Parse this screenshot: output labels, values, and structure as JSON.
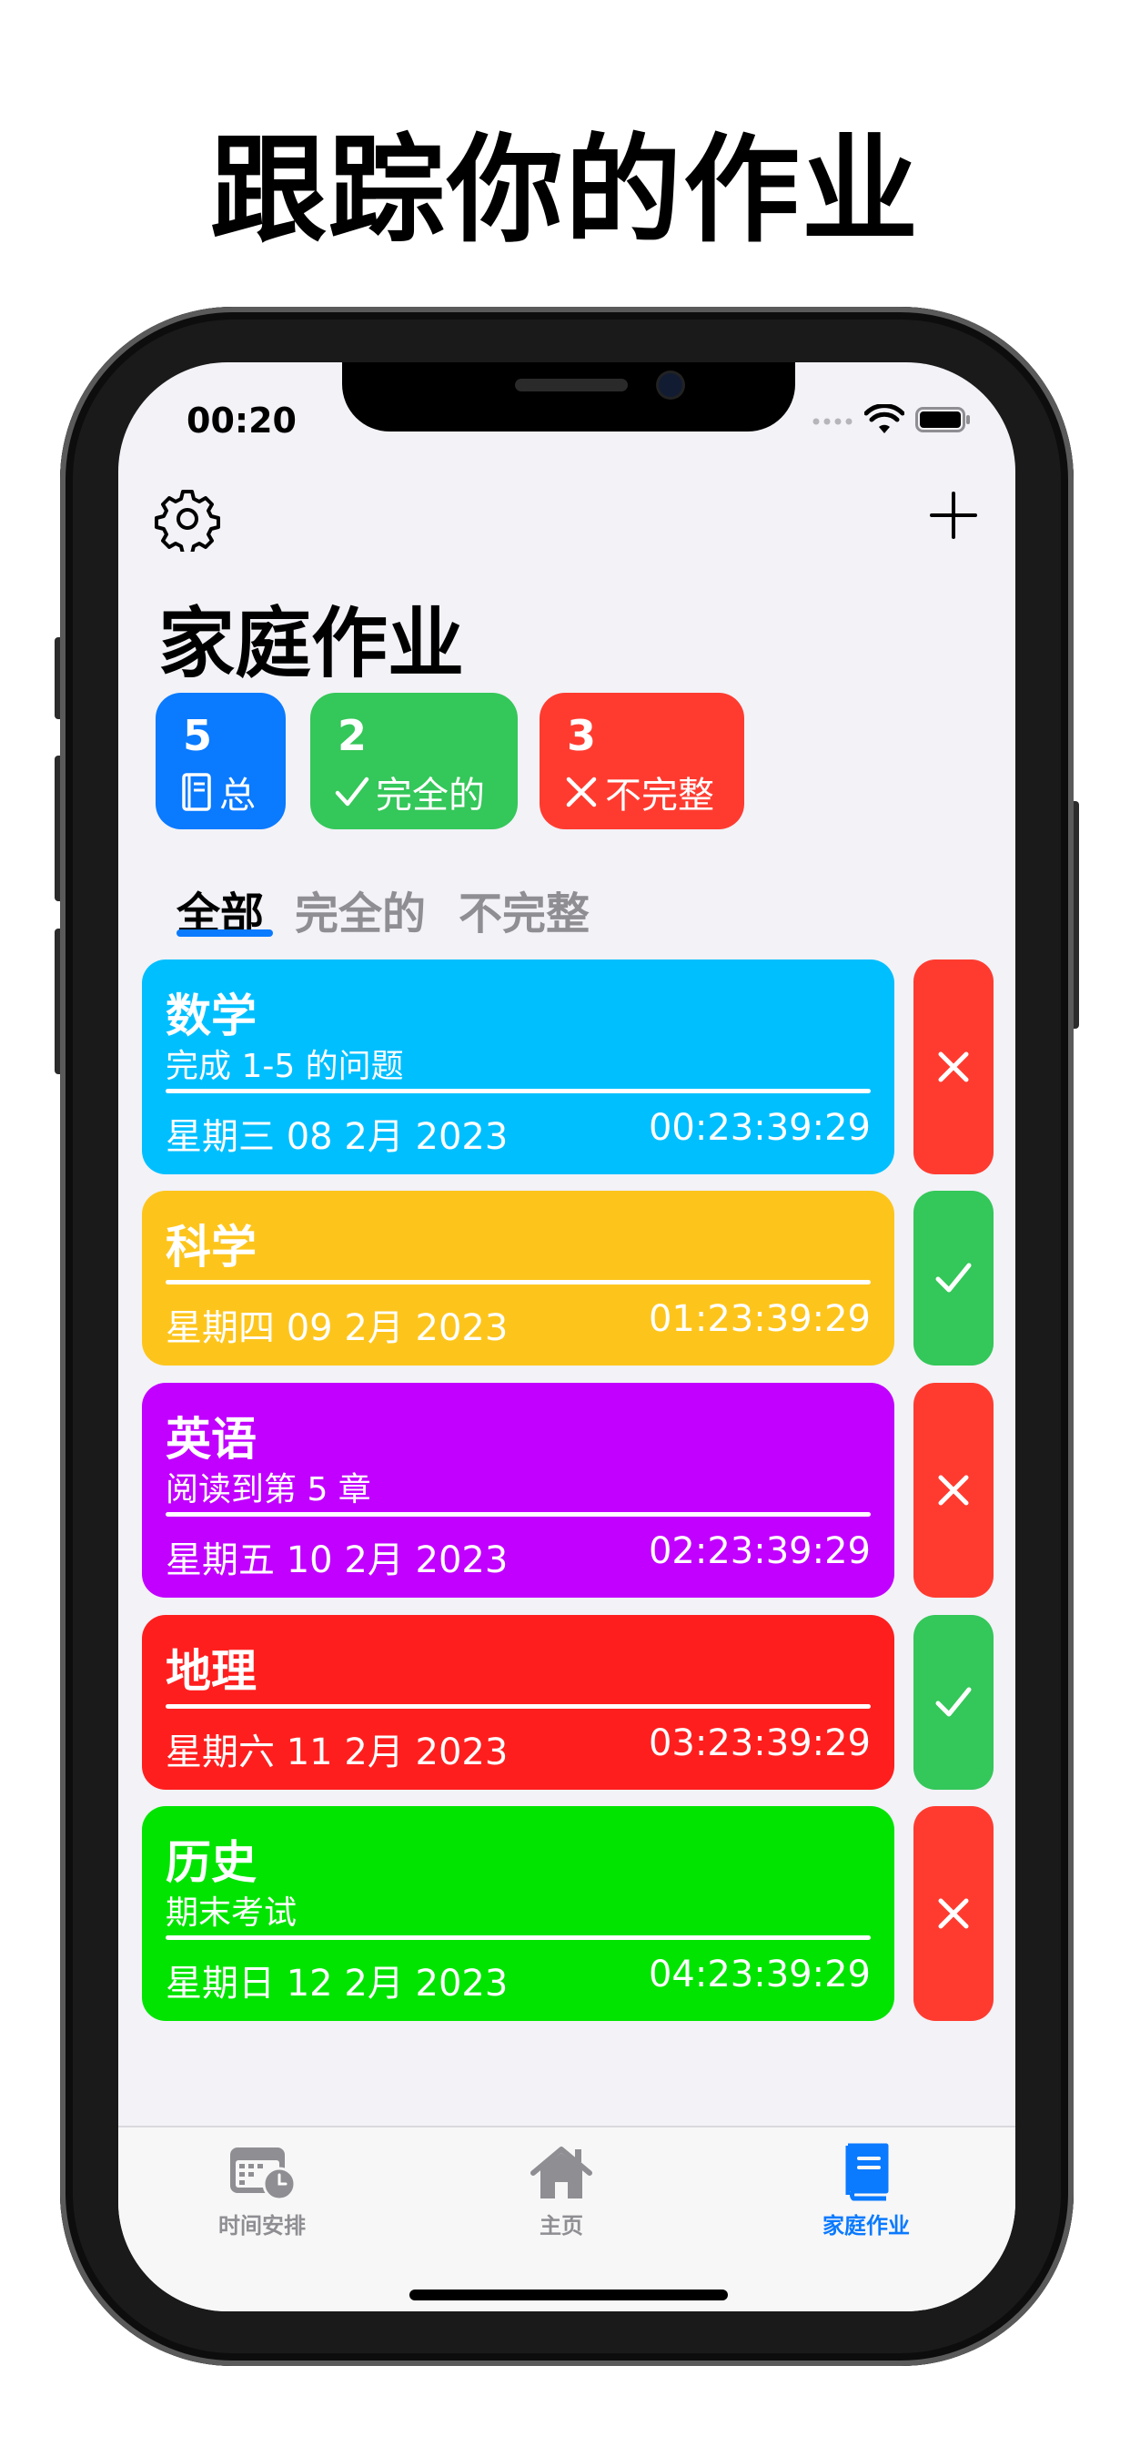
{
  "headline": "跟踪你的作业",
  "status_bar": {
    "time": "00:20"
  },
  "header": {
    "title": "家庭作业",
    "settings_icon": "gear-icon",
    "add_icon": "plus-icon"
  },
  "stats": [
    {
      "count": "5",
      "label": "总",
      "icon": "notebook-icon",
      "color": "#0a7aff"
    },
    {
      "count": "2",
      "label": "完全的",
      "icon": "checkmark-icon",
      "color": "#34c759"
    },
    {
      "count": "3",
      "label": "不完整",
      "icon": "xmark-icon",
      "color": "#ff3b30"
    }
  ],
  "filter_tabs": [
    {
      "label": "全部",
      "selected": true
    },
    {
      "label": "完全的",
      "selected": false
    },
    {
      "label": "不完整",
      "selected": false
    }
  ],
  "assignments": [
    {
      "subject": "数学",
      "description": "完成 1-5 的问题",
      "date": "星期三 08 2月 2023",
      "remaining": "00:23:39:29",
      "color": "#00bfff",
      "status": "incomplete",
      "action_icon": "xmark-icon"
    },
    {
      "subject": "科学",
      "description": "",
      "date": "星期四 09 2月 2023",
      "remaining": "01:23:39:29",
      "color": "#fdc51c",
      "status": "complete",
      "action_icon": "checkmark-icon"
    },
    {
      "subject": "英语",
      "description": "阅读到第 5 章",
      "date": "星期五 10 2月 2023",
      "remaining": "02:23:39:29",
      "color": "#c100ff",
      "status": "incomplete",
      "action_icon": "xmark-icon"
    },
    {
      "subject": "地理",
      "description": "",
      "date": "星期六 11 2月 2023",
      "remaining": "03:23:39:29",
      "color": "#ff1e1e",
      "status": "complete",
      "action_icon": "checkmark-icon"
    },
    {
      "subject": "历史",
      "description": "期末考试",
      "date": "星期日 12 2月 2023",
      "remaining": "04:23:39:29",
      "color": "#00e400",
      "status": "incomplete",
      "action_icon": "xmark-icon"
    }
  ],
  "tab_bar": [
    {
      "label": "时间安排",
      "icon": "calendar-clock-icon",
      "selected": false
    },
    {
      "label": "主页",
      "icon": "house-icon",
      "selected": false
    },
    {
      "label": "家庭作业",
      "icon": "book-icon",
      "selected": true
    }
  ],
  "colors": {
    "accent": "#0a7aff",
    "complete": "#34c759",
    "incomplete": "#ff3b30",
    "inactive": "#8e8e93"
  }
}
